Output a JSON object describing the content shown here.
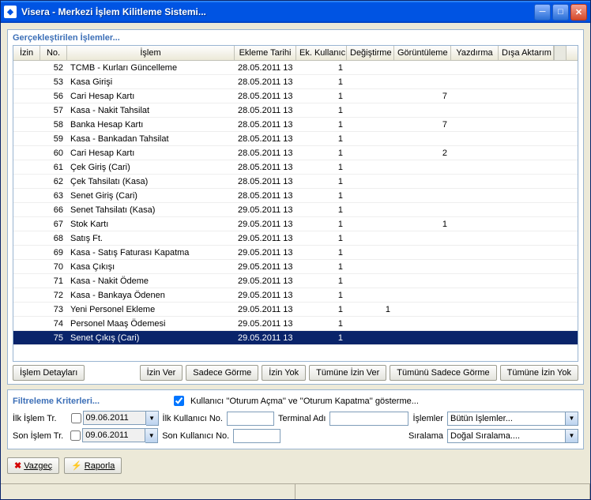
{
  "window": {
    "title": "Visera - Merkezi İşlem Kilitleme Sistemi..."
  },
  "section1": {
    "title": "Gerçekleştirilen İşlemler..."
  },
  "grid": {
    "headers": {
      "izin": "İzin",
      "no": "No.",
      "islem": "İşlem",
      "tarih": "Ekleme Tarihi",
      "ek": "Ek. Kullanıcı",
      "deg": "Değiştirme",
      "gor": "Görüntüleme",
      "yaz": "Yazdırma",
      "disa": "Dışa Aktarım"
    },
    "rows": [
      {
        "no": "52",
        "islem": "TCMB - Kurları Güncelleme",
        "tarih": "28.05.2011 13",
        "ek": "1",
        "deg": "",
        "gor": "",
        "yaz": "",
        "disa": ""
      },
      {
        "no": "53",
        "islem": "Kasa Girişi",
        "tarih": "28.05.2011 13",
        "ek": "1",
        "deg": "",
        "gor": "",
        "yaz": "",
        "disa": ""
      },
      {
        "no": "56",
        "islem": "Cari Hesap Kartı",
        "tarih": "28.05.2011 13",
        "ek": "1",
        "deg": "",
        "gor": "7",
        "yaz": "",
        "disa": ""
      },
      {
        "no": "57",
        "islem": "Kasa - Nakit Tahsilat",
        "tarih": "28.05.2011 13",
        "ek": "1",
        "deg": "",
        "gor": "",
        "yaz": "",
        "disa": ""
      },
      {
        "no": "58",
        "islem": "Banka Hesap Kartı",
        "tarih": "28.05.2011 13",
        "ek": "1",
        "deg": "",
        "gor": "7",
        "yaz": "",
        "disa": ""
      },
      {
        "no": "59",
        "islem": "Kasa - Bankadan Tahsilat",
        "tarih": "28.05.2011 13",
        "ek": "1",
        "deg": "",
        "gor": "",
        "yaz": "",
        "disa": ""
      },
      {
        "no": "60",
        "islem": "Cari Hesap Kartı",
        "tarih": "28.05.2011 13",
        "ek": "1",
        "deg": "",
        "gor": "2",
        "yaz": "",
        "disa": ""
      },
      {
        "no": "61",
        "islem": "Çek Giriş (Cari)",
        "tarih": "28.05.2011 13",
        "ek": "1",
        "deg": "",
        "gor": "",
        "yaz": "",
        "disa": ""
      },
      {
        "no": "62",
        "islem": "Çek Tahsilatı (Kasa)",
        "tarih": "28.05.2011 13",
        "ek": "1",
        "deg": "",
        "gor": "",
        "yaz": "",
        "disa": ""
      },
      {
        "no": "63",
        "islem": "Senet Giriş (Cari)",
        "tarih": "28.05.2011 13",
        "ek": "1",
        "deg": "",
        "gor": "",
        "yaz": "",
        "disa": ""
      },
      {
        "no": "66",
        "islem": "Senet Tahsilatı (Kasa)",
        "tarih": "29.05.2011 13",
        "ek": "1",
        "deg": "",
        "gor": "",
        "yaz": "",
        "disa": ""
      },
      {
        "no": "67",
        "islem": "Stok Kartı",
        "tarih": "29.05.2011 13",
        "ek": "1",
        "deg": "",
        "gor": "1",
        "yaz": "",
        "disa": ""
      },
      {
        "no": "68",
        "islem": "Satış Ft.",
        "tarih": "29.05.2011 13",
        "ek": "1",
        "deg": "",
        "gor": "",
        "yaz": "",
        "disa": ""
      },
      {
        "no": "69",
        "islem": "Kasa - Satış Faturası Kapatma",
        "tarih": "29.05.2011 13",
        "ek": "1",
        "deg": "",
        "gor": "",
        "yaz": "",
        "disa": ""
      },
      {
        "no": "70",
        "islem": "Kasa Çıkışı",
        "tarih": "29.05.2011 13",
        "ek": "1",
        "deg": "",
        "gor": "",
        "yaz": "",
        "disa": ""
      },
      {
        "no": "71",
        "islem": "Kasa - Nakit Ödeme",
        "tarih": "29.05.2011 13",
        "ek": "1",
        "deg": "",
        "gor": "",
        "yaz": "",
        "disa": ""
      },
      {
        "no": "72",
        "islem": "Kasa - Bankaya Ödenen",
        "tarih": "29.05.2011 13",
        "ek": "1",
        "deg": "",
        "gor": "",
        "yaz": "",
        "disa": ""
      },
      {
        "no": "73",
        "islem": "Yeni Personel Ekleme",
        "tarih": "29.05.2011 13",
        "ek": "1",
        "deg": "1",
        "gor": "",
        "yaz": "",
        "disa": ""
      },
      {
        "no": "74",
        "islem": "Personel Maaş Ödemesi",
        "tarih": "29.05.2011 13",
        "ek": "1",
        "deg": "",
        "gor": "",
        "yaz": "",
        "disa": ""
      },
      {
        "no": "75",
        "islem": "Senet Çıkış (Cari)",
        "tarih": "29.05.2011 13",
        "ek": "1",
        "deg": "",
        "gor": "",
        "yaz": "",
        "disa": "",
        "selected": true
      }
    ]
  },
  "buttons": {
    "detay": "İşlem Detayları",
    "izinver": "İzin Ver",
    "sadecegorme": "Sadece Görme",
    "izinyok": "İzin Yok",
    "tumune_izinver": "Tümüne İzin Ver",
    "tumunu_sadecegorme": "Tümünü Sadece Görme",
    "tumune_izinyok": "Tümüne İzin Yok"
  },
  "filter": {
    "title": "Filtreleme Kriterleri...",
    "check_label": "Kullanıcı ''Oturum Açma'' ve ''Oturum Kapatma'' gösterme...",
    "ilk_islem": "İlk İşlem Tr.",
    "son_islem": "Son İşlem Tr.",
    "ilk_kullanici": "İlk Kullanıcı No.",
    "son_kullanici": "Son Kullanıcı No.",
    "terminal": "Terminal Adı",
    "islemler": "İşlemler",
    "siralama": "Sıralama",
    "date1": "09.06.2011",
    "date2": "09.06.2011",
    "islemler_val": "Bütün İşlemler...",
    "siralama_val": "Doğal Sıralama...."
  },
  "footer": {
    "vazgec": "Vazgeç",
    "raporla": "Raporla"
  }
}
